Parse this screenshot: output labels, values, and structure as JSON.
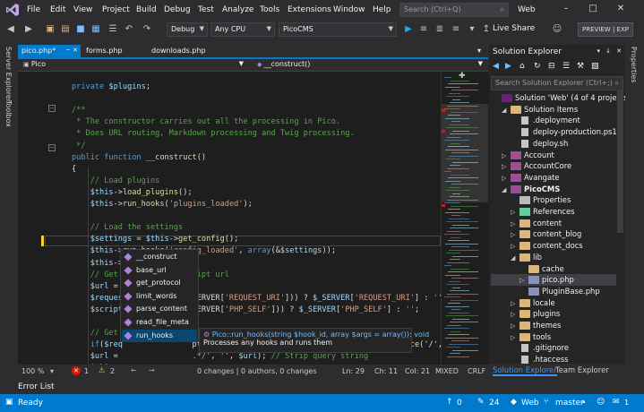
{
  "menu": {
    "items": [
      "File",
      "Edit",
      "View",
      "Project",
      "Build",
      "Debug",
      "Test",
      "Analyze",
      "Tools",
      "Extensions",
      "Window",
      "Help"
    ],
    "search_placeholder": "Search (Ctrl+Q)",
    "solution_label": "Web"
  },
  "toolbar": {
    "config": "Debug",
    "platform": "Any CPU",
    "startup": "PicoCMS",
    "live_share": "Live Share",
    "preview": "PREVIEW | EXP"
  },
  "left_tools": [
    "Server Explorer",
    "Toolbox"
  ],
  "right_tools": [
    "Properties"
  ],
  "tabs": {
    "active": "pico.php*",
    "others": [
      "forms.php",
      "downloads.php"
    ]
  },
  "navbar": {
    "left": "Pico",
    "right": "__construct()"
  },
  "code": {
    "lines": [
      [
        [
          "kw",
          "private "
        ],
        [
          "var",
          "$plugins"
        ],
        [
          "",
          "; "
        ]
      ],
      [
        [
          "",
          ""
        ]
      ],
      [
        [
          "cm",
          "/**"
        ]
      ],
      [
        [
          "cm",
          " * The constructor carries out all the processing in Pico."
        ]
      ],
      [
        [
          "cm",
          " * Does URL routing, Markdown processing and Twig processing."
        ]
      ],
      [
        [
          "cm",
          " */"
        ]
      ],
      [
        [
          "kw",
          "public function "
        ],
        [
          "fn",
          "__construct"
        ],
        [
          "",
          "()"
        ]
      ],
      [
        [
          "",
          "{"
        ]
      ],
      [
        [
          "cm",
          "    // Load plugins"
        ]
      ],
      [
        [
          "var",
          "    $this"
        ],
        [
          "",
          "->"
        ],
        [
          "fn",
          "load_plugins"
        ],
        [
          "",
          "();"
        ]
      ],
      [
        [
          "var",
          "    $this"
        ],
        [
          "",
          "->"
        ],
        [
          "fn",
          "run_hooks"
        ],
        [
          "",
          "("
        ],
        [
          "str",
          "'plugins_loaded'"
        ],
        [
          "",
          ");"
        ]
      ],
      [
        [
          "",
          ""
        ]
      ],
      [
        [
          "cm",
          "    // Load the settings"
        ]
      ],
      [
        [
          "var",
          "    $settings"
        ],
        [
          "",
          " = "
        ],
        [
          "var",
          "$this"
        ],
        [
          "",
          "->"
        ],
        [
          "fn",
          "get_config"
        ],
        [
          "",
          "();"
        ]
      ],
      [
        [
          "var",
          "    $this"
        ],
        [
          "",
          "->"
        ],
        [
          "fn",
          "run_hooks"
        ],
        [
          "",
          "("
        ],
        [
          "str",
          "'config_loaded'"
        ],
        [
          "",
          ", "
        ],
        [
          "kw",
          "array"
        ],
        [
          "",
          "(&"
        ],
        [
          "var",
          "$settings"
        ],
        [
          "",
          "));"
        ]
      ],
      [
        [
          "var",
          "    $this"
        ],
        [
          "",
          "->r"
        ]
      ],
      [
        [
          "cm",
          "    // Get"
        ],
        [
          "",
          ""
        ],
        [
          "cm",
          "               cript url"
        ]
      ],
      [
        [
          "var",
          "    $url"
        ],
        [
          "",
          " ="
        ]
      ],
      [
        [
          "var",
          "    $reques"
        ],
        [
          "",
          ""
        ],
        [
          "",
          "                ERVER["
        ],
        [
          "str",
          "'REQUEST_URI'"
        ],
        [
          "",
          "])) ? "
        ],
        [
          "var",
          "$_SERVER"
        ],
        [
          "",
          "["
        ],
        [
          "str",
          "'REQUEST_URI'"
        ],
        [
          "",
          "] : "
        ],
        [
          "str",
          "''"
        ]
      ],
      [
        [
          "var",
          "    $script"
        ],
        [
          "",
          "                ERVER["
        ],
        [
          "str",
          "'PHP_SELF'"
        ],
        [
          "",
          "])) ? "
        ],
        [
          "var",
          "$_SERVER"
        ],
        [
          "",
          "["
        ],
        [
          "str",
          "'PHP_SELF'"
        ],
        [
          "",
          "] : "
        ],
        [
          "str",
          "''"
        ],
        [
          "",
          ";"
        ]
      ],
      [
        [
          "",
          ""
        ]
      ],
      [
        [
          "cm",
          "    // Get"
        ],
        [
          "cm",
          "                trim the / of the left and the right"
        ]
      ],
      [
        [
          "kw",
          "    if"
        ],
        [
          "",
          "("
        ],
        [
          "var",
          "$req"
        ],
        [
          "",
          "               pt_url) "
        ],
        [
          "var",
          "$url"
        ],
        [
          "",
          " = "
        ],
        [
          "fn",
          "trim"
        ],
        [
          "",
          "("
        ],
        [
          "fn",
          "preg_replace"
        ],
        [
          "",
          "("
        ],
        [
          "str",
          "'/'"
        ],
        [
          "",
          ". "
        ],
        [
          "fn",
          "str_replace"
        ],
        [
          "",
          "('/',"
        ]
      ],
      [
        [
          "var",
          "    $url"
        ],
        [
          "",
          " ="
        ],
        [
          "",
          "                "
        ],
        [
          "str",
          ".*/'"
        ],
        [
          "",
          ", "
        ],
        [
          "str",
          "''"
        ],
        [
          "",
          ", "
        ],
        [
          "var",
          "$url"
        ],
        [
          "",
          "); "
        ],
        [
          "cm",
          "// Strip query string"
        ]
      ],
      [
        [
          "var",
          "    $this"
        ],
        [
          "",
          "->"
        ]
      ],
      [
        [
          "",
          ""
        ]
      ],
      [
        [
          "cm",
          "    // Get the file path"
        ]
      ],
      [
        [
          "kw",
          "    if"
        ],
        [
          "",
          "("
        ],
        [
          "var",
          "$url"
        ],
        [
          "",
          ") "
        ],
        [
          "var",
          "$file"
        ],
        [
          "",
          " = "
        ],
        [
          "var",
          "$settings"
        ],
        [
          "",
          "["
        ],
        [
          "str",
          "'content_dir'"
        ],
        [
          "",
          "] . "
        ],
        [
          "var",
          "$url"
        ],
        [
          "",
          ";"
        ]
      ]
    ]
  },
  "intellisense": {
    "items": [
      "__construct",
      "base_url",
      "get_protocol",
      "limit_words",
      "parse_content",
      "read_file_meta",
      "run_hooks"
    ],
    "selected": "run_hooks",
    "tooltip_sig": "Pico::run_hooks(string $hook_id, array $args = array()): void",
    "tooltip_desc": "Processes any hooks and runs them"
  },
  "editor_status": {
    "zoom": "100 %",
    "errors": "1",
    "warnings": "2",
    "changes": "0 changes | 0 authors, 0 changes",
    "line": "Ln: 29",
    "col": "Ch: 11",
    "pos": "Col: 21",
    "mode": "MIXED",
    "eol": "CRLF"
  },
  "solution_explorer": {
    "title": "Solution Explorer",
    "search_placeholder": "Search Solution Explorer (Ctrl+;)",
    "rows": [
      {
        "indent": 0,
        "exp": "",
        "icon": "sol",
        "label": "Solution 'Web' (4 of 4 projects)"
      },
      {
        "indent": 1,
        "exp": "◢",
        "icon": "folder",
        "label": "Solution Items"
      },
      {
        "indent": 2,
        "exp": "",
        "icon": "file",
        "label": ".deployment"
      },
      {
        "indent": 2,
        "exp": "",
        "icon": "file",
        "label": "deploy-production.ps1"
      },
      {
        "indent": 2,
        "exp": "",
        "icon": "file",
        "label": "deploy.sh"
      },
      {
        "indent": 1,
        "exp": "▷",
        "icon": "proj",
        "label": "Account"
      },
      {
        "indent": 1,
        "exp": "▷",
        "icon": "proj",
        "label": "AccountCore"
      },
      {
        "indent": 1,
        "exp": "▷",
        "icon": "proj",
        "label": "Avangate"
      },
      {
        "indent": 1,
        "exp": "◢",
        "icon": "proj",
        "label": "PicoCMS",
        "bold": true
      },
      {
        "indent": 2,
        "exp": "",
        "icon": "wrench",
        "label": "Properties"
      },
      {
        "indent": 2,
        "exp": "▷",
        "icon": "refs",
        "label": "References"
      },
      {
        "indent": 2,
        "exp": "▷",
        "icon": "folder",
        "label": "content"
      },
      {
        "indent": 2,
        "exp": "▷",
        "icon": "folder",
        "label": "content_blog"
      },
      {
        "indent": 2,
        "exp": "▷",
        "icon": "folder",
        "label": "content_docs"
      },
      {
        "indent": 2,
        "exp": "◢",
        "icon": "folder",
        "label": "lib"
      },
      {
        "indent": 3,
        "exp": "",
        "icon": "folder",
        "label": "cache"
      },
      {
        "indent": 3,
        "exp": "▷",
        "icon": "php",
        "label": "pico.php",
        "selected": true
      },
      {
        "indent": 3,
        "exp": "",
        "icon": "php",
        "label": "PluginBase.php"
      },
      {
        "indent": 2,
        "exp": "▷",
        "icon": "folder",
        "label": "locale"
      },
      {
        "indent": 2,
        "exp": "▷",
        "icon": "folder",
        "label": "plugins"
      },
      {
        "indent": 2,
        "exp": "▷",
        "icon": "folder",
        "label": "themes"
      },
      {
        "indent": 2,
        "exp": "▷",
        "icon": "folder",
        "label": "tools"
      },
      {
        "indent": 2,
        "exp": "",
        "icon": "file",
        "label": ".gitignore"
      },
      {
        "indent": 2,
        "exp": "",
        "icon": "file",
        "label": ".htaccess"
      }
    ],
    "tabs": [
      "Solution Explorer",
      "Team Explorer"
    ]
  },
  "error_list": "Error List",
  "status": {
    "ready": "Ready",
    "up": "0",
    "pencil": "24",
    "repo": "Web",
    "branch": "master",
    "notify": "1"
  },
  "colors": {
    "accent": "#007acc",
    "bg": "#2d2d30",
    "editor_bg": "#1e1e1e"
  }
}
